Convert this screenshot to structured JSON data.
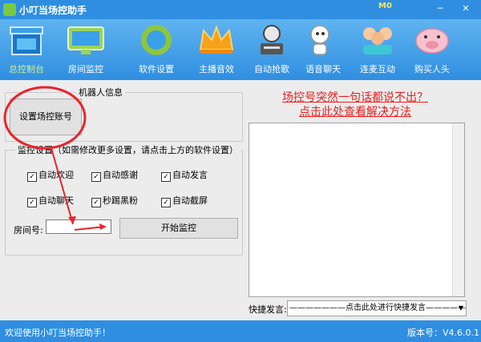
{
  "window": {
    "title": "小叮当场控助手",
    "badge": "M0"
  },
  "toolbar": {
    "items": [
      {
        "label": "总控制台",
        "icon": "storefront-icon"
      },
      {
        "label": "房间监控",
        "icon": "monitor-icon"
      },
      {
        "label": "软件设置",
        "icon": "gear-ring-icon"
      },
      {
        "label": "主播音效",
        "icon": "crown-icon"
      },
      {
        "label": "自动抢歌",
        "icon": "robot-dj-icon"
      },
      {
        "label": "语音聊天",
        "icon": "robot-chat-icon"
      },
      {
        "label": "连麦互动",
        "icon": "cartoon-kids-icon"
      },
      {
        "label": "购买人头",
        "icon": "pig-icon"
      }
    ]
  },
  "robot_panel": {
    "legend": "机器人信息",
    "setup_button": "设置场控账号"
  },
  "monitor_panel": {
    "legend": "监控设置（如需修改更多设置，请点击上方的软件设置）",
    "checkboxes": [
      {
        "label": "自动欢迎",
        "checked": true
      },
      {
        "label": "自动感谢",
        "checked": true
      },
      {
        "label": "自动发言",
        "checked": true
      },
      {
        "label": "自动聊天",
        "checked": true
      },
      {
        "label": "秒踢黑粉",
        "checked": true
      },
      {
        "label": "自动截屏",
        "checked": true
      }
    ],
    "room_label": "房间号:",
    "room_value": "",
    "start_button": "开始监控"
  },
  "help": {
    "line1": "场控号突然一句话都说不出？",
    "line2": "点击此处查看解决方法"
  },
  "quick": {
    "label": "快捷发言:",
    "value": "———————点击此处进行快捷发言———————"
  },
  "status": {
    "welcome": "欢迎使用小叮当场控助手！",
    "version": "版本号：V4.6.0.1"
  },
  "colors": {
    "titlebar": "#2f8ee0",
    "accent_red": "#e3201f",
    "active_label": "#d7f07b"
  }
}
